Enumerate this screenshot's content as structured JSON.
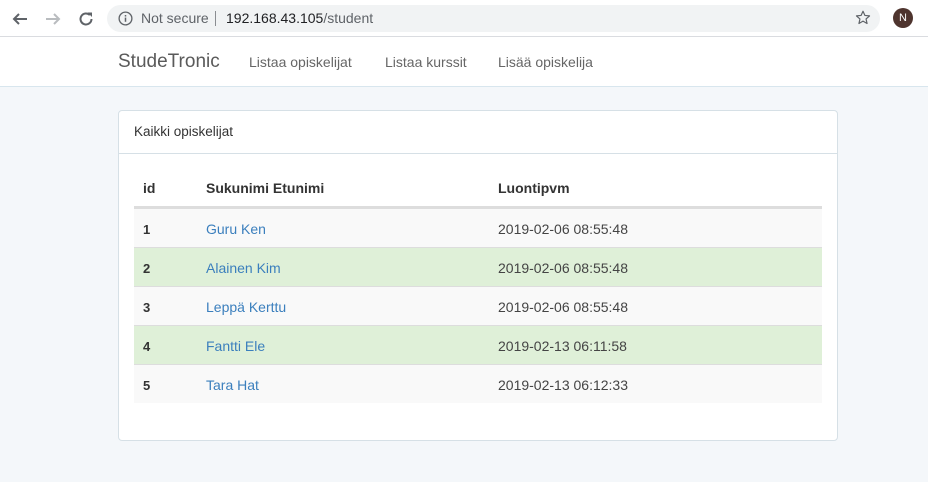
{
  "browser": {
    "security_label": "Not secure",
    "url_host": "192.168.43.105",
    "url_path": "/student",
    "profile_initial": "N"
  },
  "navbar": {
    "brand": "StudeTronic",
    "links": [
      "Listaa opiskelijat",
      "Listaa kurssit",
      "Lisää opiskelija"
    ]
  },
  "card": {
    "title": "Kaikki opiskelijat",
    "columns": [
      "id",
      "Sukunimi Etunimi",
      "Luontipvm"
    ],
    "rows": [
      {
        "id": "1",
        "name": "Guru Ken",
        "created": "2019-02-06 08:55:48"
      },
      {
        "id": "2",
        "name": "Alainen Kim",
        "created": "2019-02-06 08:55:48"
      },
      {
        "id": "3",
        "name": "Leppä Kerttu",
        "created": "2019-02-06 08:55:48"
      },
      {
        "id": "4",
        "name": "Fantti Ele",
        "created": "2019-02-13 06:11:58"
      },
      {
        "id": "5",
        "name": "Tara Hat",
        "created": "2019-02-13 06:12:33"
      }
    ]
  },
  "colors": {
    "link": "#3b7fbd",
    "success_row": "#dff0d8",
    "striped_row": "#f9f9f9"
  }
}
